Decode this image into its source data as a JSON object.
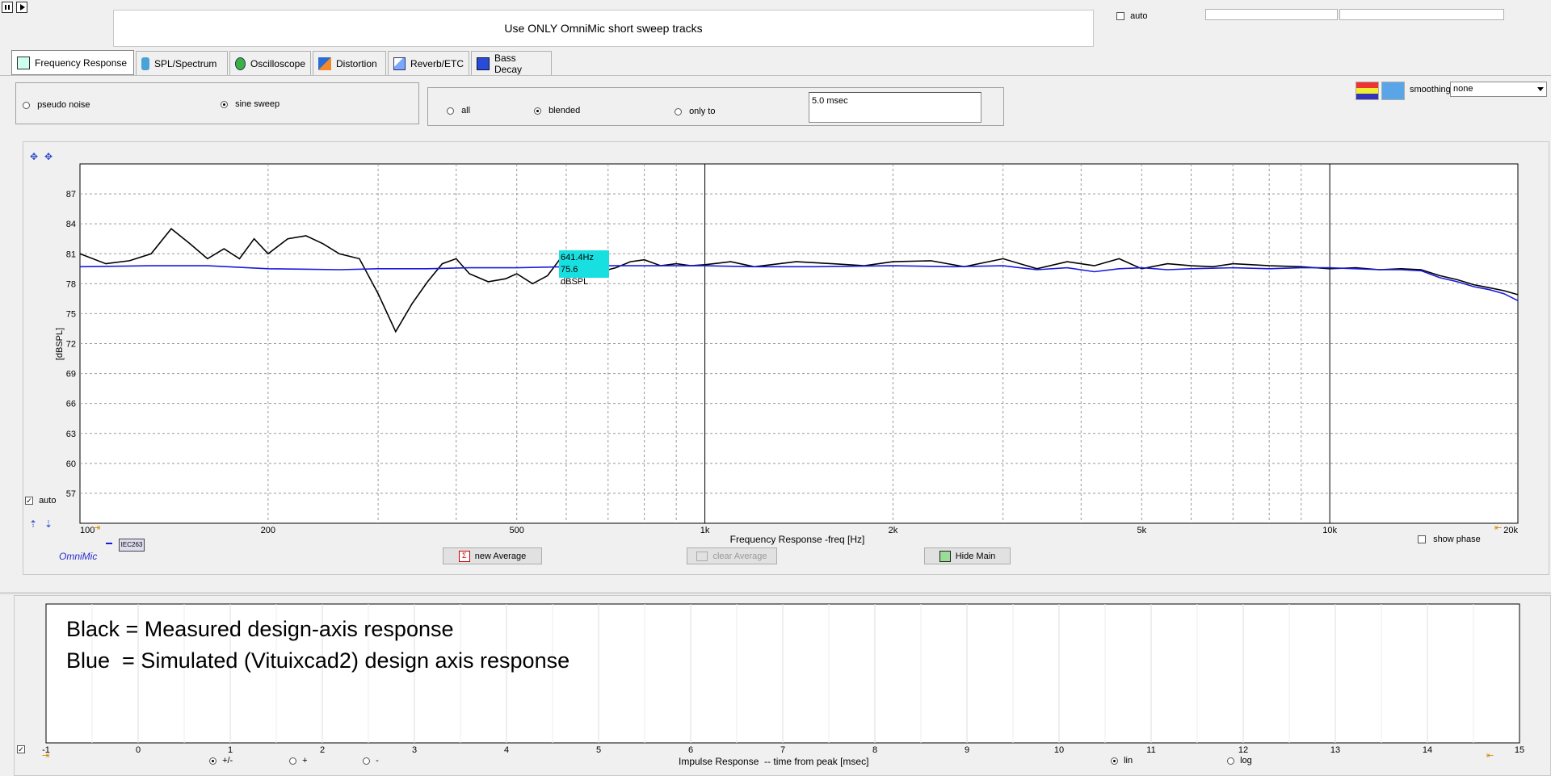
{
  "toolbar": {
    "pause_icon": "pause-icon",
    "play_icon": "play-icon"
  },
  "banner": {
    "text": "Use ONLY OmniMic short sweep tracks"
  },
  "top_auto": {
    "label": "auto",
    "checked": false
  },
  "tabs": [
    {
      "label": "Frequency Response",
      "icon": "frequency-response-icon",
      "active": true
    },
    {
      "label": "SPL/Spectrum",
      "icon": "spl-spectrum-icon",
      "active": false
    },
    {
      "label": "Oscilloscope",
      "icon": "oscilloscope-icon",
      "active": false
    },
    {
      "label": "Distortion",
      "icon": "distortion-icon",
      "active": false
    },
    {
      "label": "Reverb/ETC",
      "icon": "reverb-etc-icon",
      "active": false
    },
    {
      "label": "Bass Decay",
      "icon": "bass-decay-icon",
      "active": false
    }
  ],
  "signal": {
    "pseudo_noise": "pseudo noise",
    "sine_sweep": "sine sweep",
    "selected": "sine sweep"
  },
  "window": {
    "all": "all",
    "blended": "blended",
    "only_to": "only to",
    "selected": "blended",
    "time_value": "5.0 msec"
  },
  "smoothing": {
    "label": "smoothing",
    "value": "none"
  },
  "colors": {
    "measured": "#000000",
    "simulated": "#1a1adf",
    "cursor_bg": "#19e0e0",
    "plot_bg": "#ffffff",
    "omnimic_text": "#2a2acf"
  },
  "chart_data": {
    "type": "line",
    "title": "",
    "xlabel": "Frequency Response -freq [Hz]",
    "ylabel": "[dBSPL]",
    "xscale": "log",
    "xlim": [
      100,
      20000
    ],
    "ylim": [
      54,
      90
    ],
    "grid": true,
    "x_tick_labels": [
      "100",
      "200",
      "500",
      "1k",
      "2k",
      "5k",
      "10k",
      "20k"
    ],
    "y_tick_labels": [
      "57",
      "60",
      "63",
      "66",
      "69",
      "72",
      "75",
      "78",
      "81",
      "84",
      "87"
    ],
    "series": [
      {
        "color": "#000000",
        "x": [
          100,
          110,
          120,
          130,
          140,
          150,
          160,
          170,
          180,
          190,
          200,
          215,
          230,
          245,
          260,
          280,
          300,
          320,
          340,
          360,
          380,
          400,
          420,
          450,
          480,
          500,
          530,
          560,
          600,
          640,
          680,
          720,
          760,
          800,
          850,
          900,
          950,
          1000,
          1100,
          1200,
          1400,
          1600,
          1800,
          2000,
          2300,
          2600,
          3000,
          3400,
          3800,
          4200,
          4600,
          5000,
          5500,
          6000,
          6500,
          7000,
          7500,
          8000,
          9000,
          10000,
          11000,
          12000,
          13000,
          14000,
          15000,
          16000,
          17000,
          18000,
          19000,
          20000
        ],
        "y": [
          81,
          80,
          80.3,
          81,
          83.5,
          82,
          80.5,
          81.5,
          80.5,
          82.5,
          81,
          82.5,
          82.8,
          82,
          81,
          80.5,
          77,
          73.2,
          76,
          78.2,
          80,
          80.5,
          79,
          78.2,
          78.5,
          79,
          78,
          78.8,
          81.3,
          80.3,
          79.2,
          79.6,
          80.2,
          80.4,
          79.8,
          80,
          79.8,
          79.9,
          80.2,
          79.7,
          80.2,
          80,
          79.8,
          80.2,
          80.3,
          79.7,
          80.5,
          79.5,
          80.2,
          79.8,
          80.5,
          79.5,
          80,
          79.8,
          79.7,
          80.0,
          79.9,
          79.8,
          79.7,
          79.5,
          79.6,
          79.4,
          79.5,
          79.4,
          78.8,
          78.4,
          77.9,
          77.6,
          77.3,
          76.9
        ]
      },
      {
        "color": "#1a1adf",
        "x": [
          100,
          130,
          160,
          200,
          260,
          300,
          360,
          420,
          500,
          600,
          700,
          800,
          1000,
          1200,
          1500,
          2000,
          2500,
          3000,
          3400,
          3800,
          4200,
          4600,
          5000,
          5500,
          6000,
          7000,
          8000,
          9000,
          10000,
          11000,
          12000,
          13000,
          14000,
          15000,
          16000,
          17000,
          18000,
          19000,
          20000
        ],
        "y": [
          79.7,
          79.8,
          79.8,
          79.5,
          79.4,
          79.5,
          79.5,
          79.6,
          79.6,
          79.7,
          79.8,
          79.8,
          79.8,
          79.7,
          79.7,
          79.8,
          79.7,
          79.8,
          79.4,
          79.6,
          79.2,
          79.5,
          79.6,
          79.4,
          79.5,
          79.6,
          79.5,
          79.6,
          79.6,
          79.5,
          79.4,
          79.4,
          79.3,
          78.6,
          78.2,
          77.7,
          77.4,
          77.0,
          76.3
        ]
      }
    ],
    "cursor": {
      "freq_label": "641.4Hz",
      "level_label": "75.6 dBSPL"
    }
  },
  "plot_auto": {
    "label": "auto",
    "checked": true
  },
  "mic": {
    "label": "IEC263",
    "brand": "OmniMic"
  },
  "buttons": {
    "new_average": "new Average",
    "clear_average": "clear Average",
    "hide_main": "Hide Main"
  },
  "show_phase": {
    "label": "show phase",
    "checked": false
  },
  "impulse": {
    "note_line1": "Black = Measured design-axis response",
    "note_line2": "Blue  = Simulated (Vituixcad2) design axis response",
    "xlabel": "Impulse Response  -- time from peak [msec]",
    "x_ticks": [
      "-1",
      "0",
      "1",
      "2",
      "3",
      "4",
      "5",
      "6",
      "7",
      "8",
      "9",
      "10",
      "11",
      "12",
      "13",
      "14",
      "15"
    ],
    "polarity": {
      "pm": "+/-",
      "plus": "+",
      "minus": "-",
      "selected": "+/-"
    },
    "scale": {
      "lin": "lin",
      "log": "log",
      "selected": "lin"
    }
  }
}
